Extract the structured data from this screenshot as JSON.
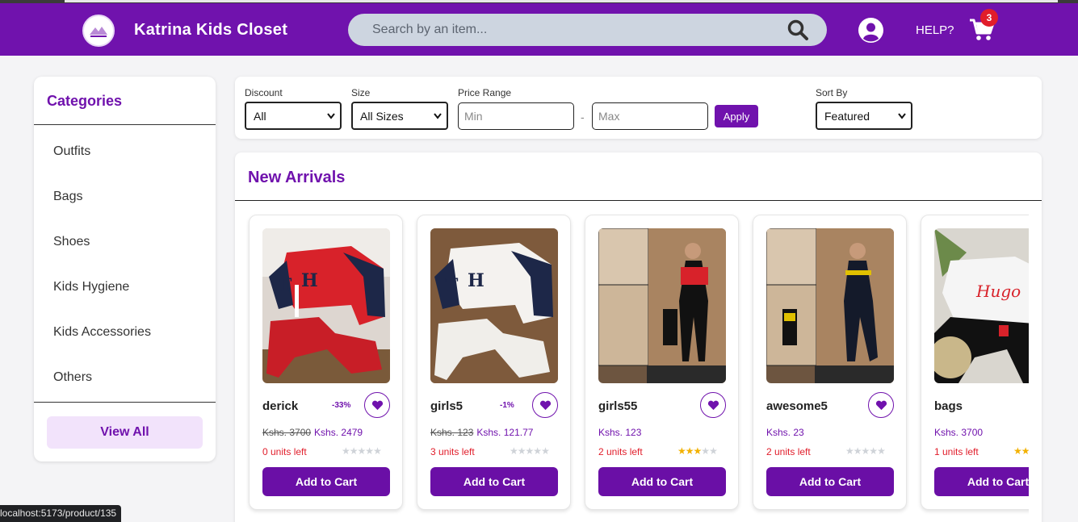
{
  "header": {
    "brand": "Katrina Kids Closet",
    "search_placeholder": "Search by an item...",
    "help_label": "HELP?",
    "cart_count": "3",
    "colors": {
      "primary": "#7012ad",
      "badge": "#e11d2a"
    }
  },
  "sidebar": {
    "title": "Categories",
    "items": [
      {
        "label": "Outfits"
      },
      {
        "label": "Bags"
      },
      {
        "label": "Shoes"
      },
      {
        "label": "Kids Hygiene"
      },
      {
        "label": "Kids Accessories"
      },
      {
        "label": "Others"
      }
    ],
    "view_all_label": "View All"
  },
  "filters": {
    "discount": {
      "label": "Discount",
      "value": "All"
    },
    "size": {
      "label": "Size",
      "value": "All Sizes"
    },
    "price": {
      "label": "Price Range",
      "min_placeholder": "Min",
      "max_placeholder": "Max",
      "separator": "-",
      "apply_label": "Apply"
    },
    "sort": {
      "label": "Sort By",
      "value": "Featured"
    }
  },
  "arrivals": {
    "title": "New Arrivals",
    "add_to_cart_label": "Add to Cart",
    "products": [
      {
        "name": "derick",
        "discount": "-33%",
        "old_price": "Kshs. 3700",
        "price": "Kshs. 2479",
        "stock": "0 units left",
        "rating": 0,
        "image": "red varsity tracksuit"
      },
      {
        "name": "girls5",
        "discount": "-1%",
        "old_price": "Kshs. 123",
        "price": "Kshs. 121.77",
        "stock": "3 units left",
        "rating": 0,
        "image": "white varsity tracksuit"
      },
      {
        "name": "girls55",
        "discount": "",
        "old_price": "",
        "price": "Kshs. 123",
        "stock": "2 units left",
        "rating": 3,
        "image": "boy in red and black tracksuit"
      },
      {
        "name": "awesome5",
        "discount": "",
        "old_price": "",
        "price": "Kshs. 23",
        "stock": "2 units left",
        "rating": 0,
        "image": "boy in black and yellow tracksuit"
      },
      {
        "name": "bags",
        "discount": "",
        "old_price": "",
        "price": "Kshs. 3700",
        "stock": "1 units left",
        "rating": 2,
        "image": "white sweater with black pants"
      }
    ]
  },
  "status_bar": {
    "url": "localhost:5173/product/135"
  }
}
